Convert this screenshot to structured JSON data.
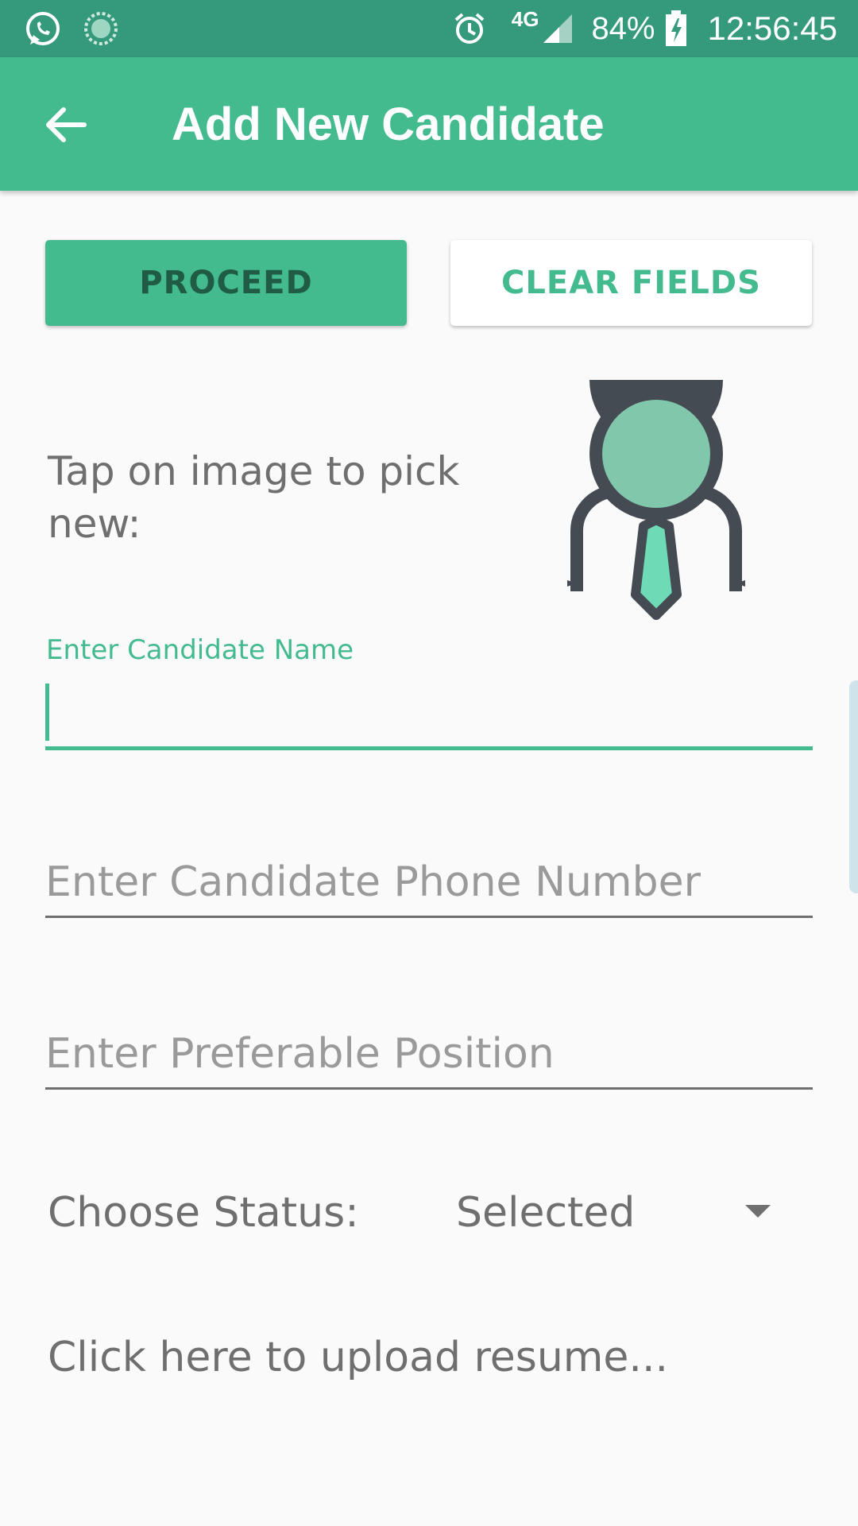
{
  "status_bar": {
    "network": "4G",
    "battery": "84%",
    "time": "12:56:45"
  },
  "app_bar": {
    "title": "Add New Candidate"
  },
  "actions": {
    "proceed_label": "PROCEED",
    "clear_label": "CLEAR FIELDS"
  },
  "picker": {
    "label": "Tap on image to pick new:"
  },
  "form": {
    "name_label": "Enter Candidate Name",
    "name_value": "",
    "phone_placeholder": "Enter Candidate Phone Number",
    "position_placeholder": "Enter Preferable Position",
    "status_label": "Choose Status:",
    "status_value": "Selected",
    "upload_label": "Click here to upload resume..."
  },
  "colors": {
    "accent": "#43bb8f",
    "status_bar": "#359a7b",
    "text_muted": "#6f6f6f"
  },
  "icons": {
    "whatsapp": "whatsapp-icon",
    "sync": "sync-icon",
    "alarm": "alarm-icon",
    "signal": "signal-icon",
    "battery": "battery-charging-icon",
    "back": "arrow-back-icon",
    "avatar": "candidate-avatar-icon",
    "dropdown": "triangle-down-icon"
  }
}
